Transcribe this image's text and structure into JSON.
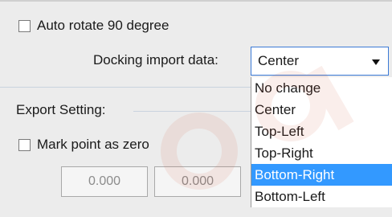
{
  "auto_rotate": {
    "label": "Auto rotate 90 degree",
    "checked": false
  },
  "docking": {
    "label": "Docking import data:",
    "selected": "Center",
    "options": [
      "No change",
      "Center",
      "Top-Left",
      "Top-Right",
      "Bottom-Right",
      "Bottom-Left"
    ],
    "highlighted_index": 4
  },
  "export": {
    "title": "Export Setting:",
    "mark_point": {
      "label": "Mark point as zero",
      "checked": false
    },
    "x_value": "0.000",
    "y_value": "0.000"
  },
  "colors": {
    "accent": "#3399ff",
    "panel": "#ececec"
  }
}
